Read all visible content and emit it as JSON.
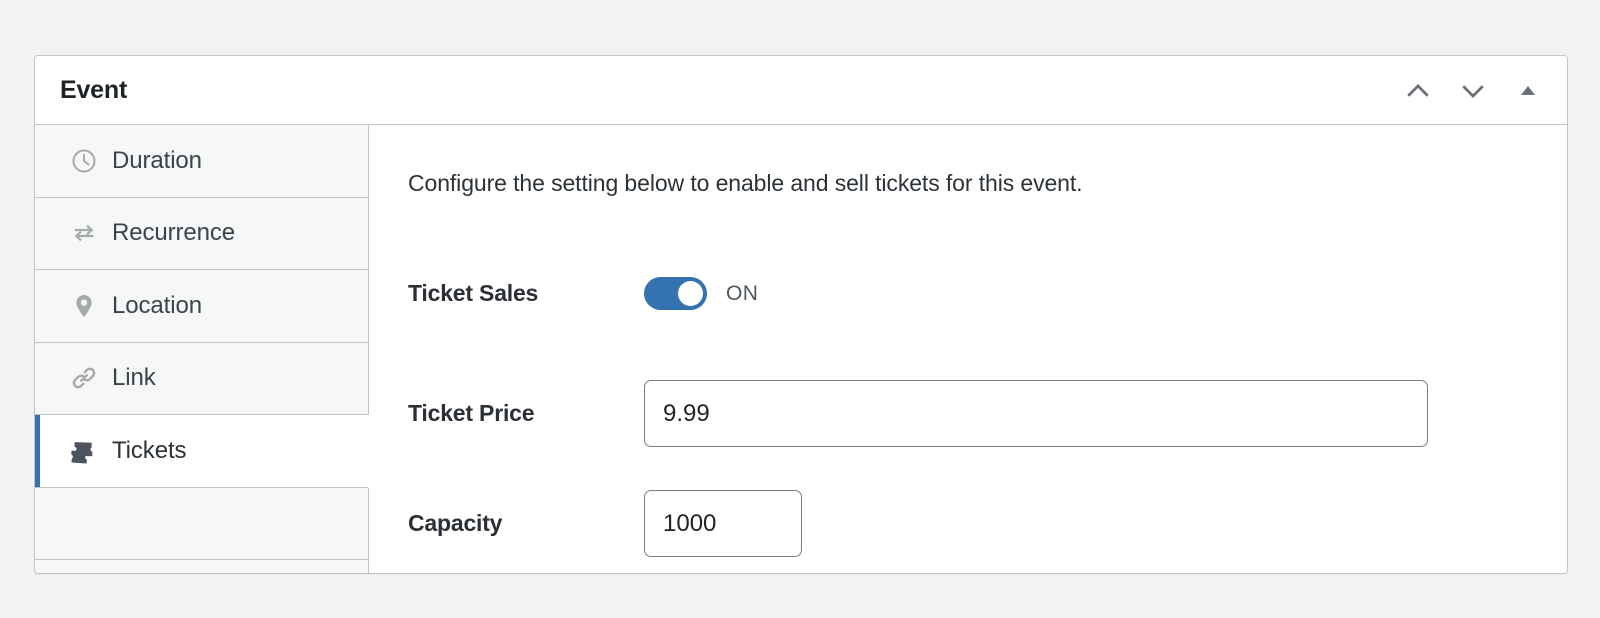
{
  "panel": {
    "title": "Event",
    "header_actions": [
      {
        "name": "move-up-button",
        "icon": "chevron-up-icon"
      },
      {
        "name": "move-down-button",
        "icon": "chevron-down-icon"
      },
      {
        "name": "collapse-button",
        "icon": "triangle-up-icon"
      }
    ]
  },
  "sidebar": {
    "items": [
      {
        "label": "Duration",
        "icon": "clock-icon",
        "active": false
      },
      {
        "label": "Recurrence",
        "icon": "repeat-icon",
        "active": false
      },
      {
        "label": "Location",
        "icon": "map-pin-icon",
        "active": false
      },
      {
        "label": "Link",
        "icon": "link-icon",
        "active": false
      },
      {
        "label": "Tickets",
        "icon": "tickets-icon",
        "active": true
      }
    ]
  },
  "content": {
    "intro": "Configure the setting below to enable and sell tickets for this event.",
    "fields": {
      "ticket_sales": {
        "label": "Ticket Sales",
        "state_label": "ON",
        "enabled": true
      },
      "ticket_price": {
        "label": "Ticket Price",
        "value": "9.99",
        "placeholder": ""
      },
      "capacity": {
        "label": "Capacity",
        "value": "1000",
        "placeholder": ""
      }
    }
  },
  "colors": {
    "accent": "#3572b0",
    "page_background": "#f1f2f3",
    "tab_background": "#f6f7f7",
    "border": "#c3c4c7",
    "text": "#2c3338",
    "icon_gray": "#a7aaad",
    "icon_dark": "#4b535c"
  }
}
